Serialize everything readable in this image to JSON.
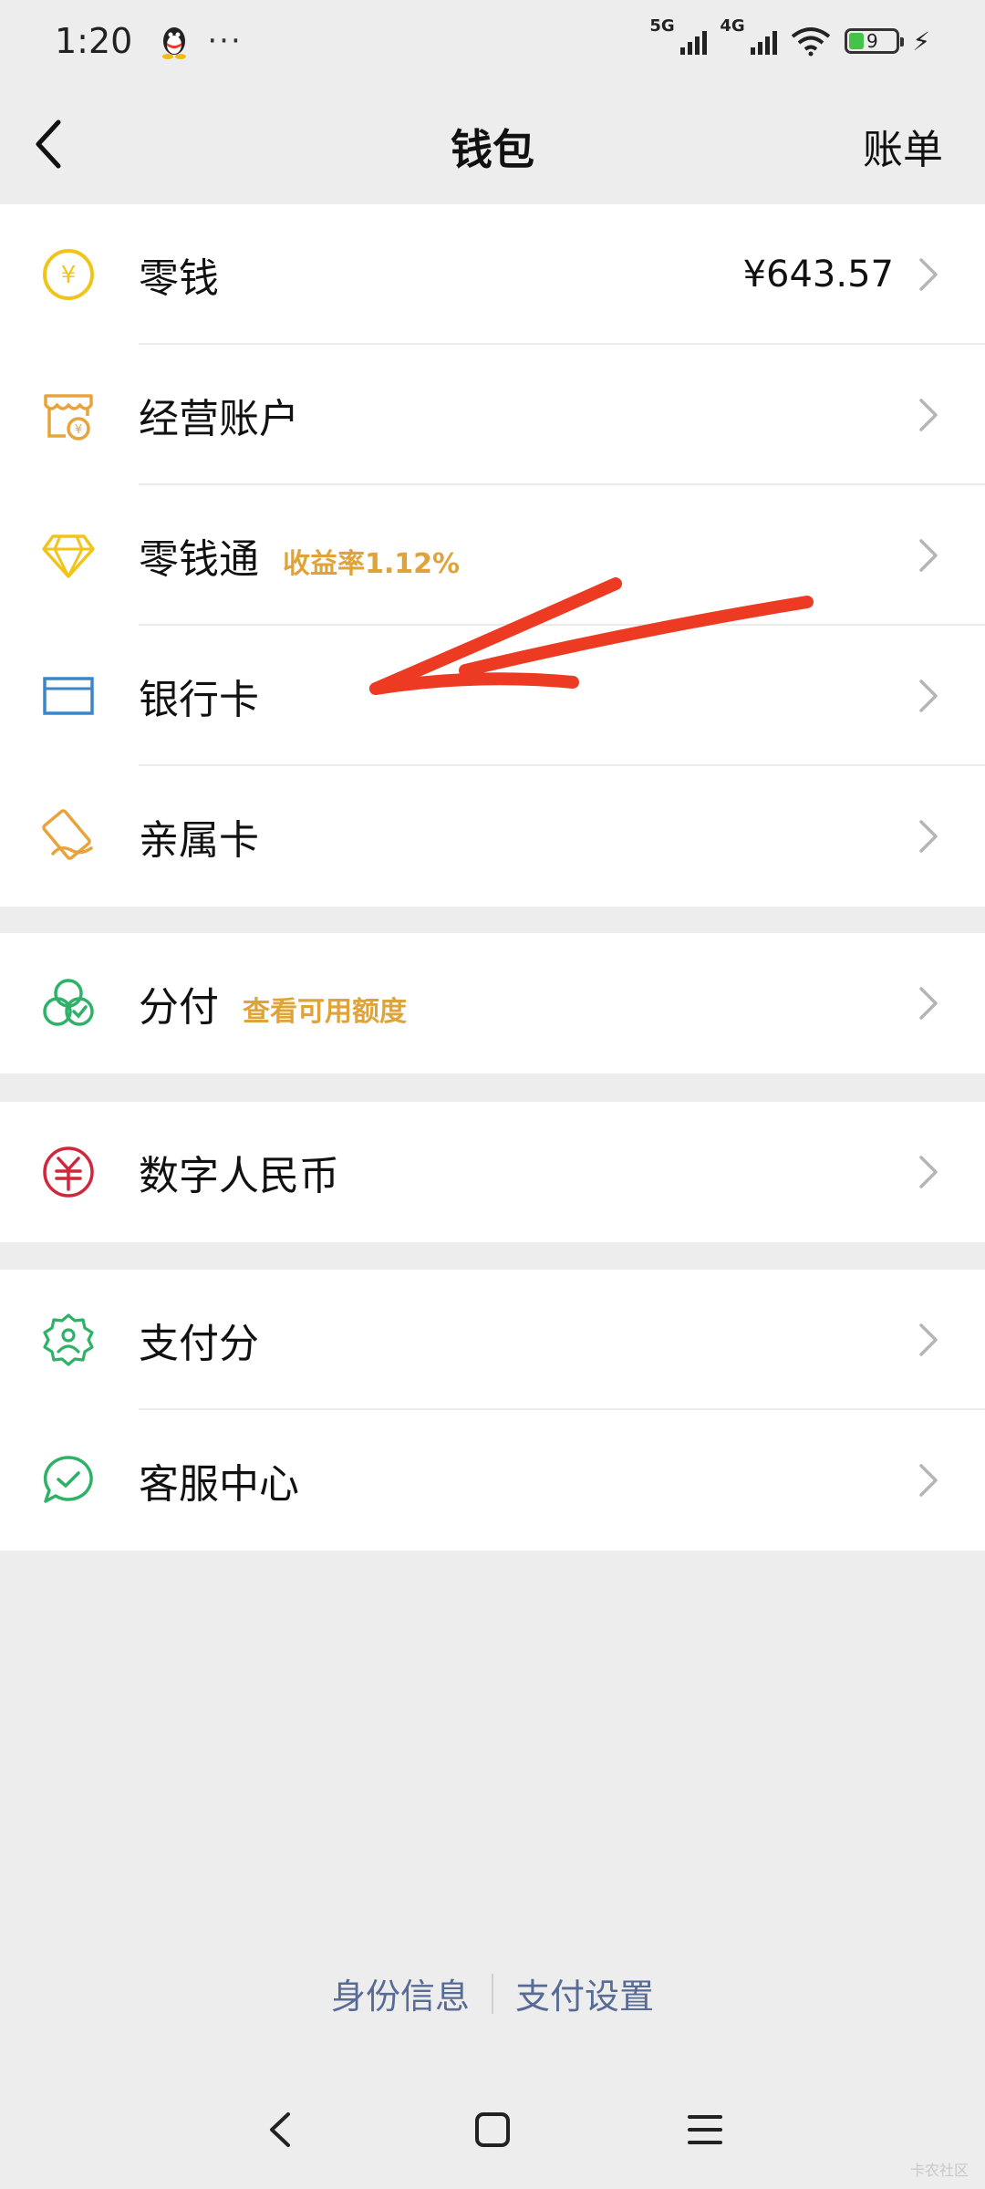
{
  "status_bar": {
    "time": "1:20",
    "dots": "···",
    "sig1": "5G",
    "sig2": "4G",
    "battery": "9"
  },
  "nav": {
    "title": "钱包",
    "bill": "账单"
  },
  "group1": {
    "items": [
      {
        "label": "零钱",
        "value": "¥643.57"
      },
      {
        "label": "经营账户"
      },
      {
        "label": "零钱通",
        "tag": "收益率1.12%"
      },
      {
        "label": "银行卡"
      },
      {
        "label": "亲属卡"
      }
    ]
  },
  "group2": {
    "items": [
      {
        "label": "分付",
        "tag": "查看可用额度"
      }
    ]
  },
  "group3": {
    "items": [
      {
        "label": "数字人民币"
      }
    ]
  },
  "group4": {
    "items": [
      {
        "label": "支付分"
      },
      {
        "label": "客服中心"
      }
    ]
  },
  "footer": {
    "identity": "身份信息",
    "pay_settings": "支付设置"
  },
  "watermark": "卡农社区",
  "colors": {
    "yellow": "#f0c419",
    "orange": "#e8a33c",
    "blue": "#3b86c8",
    "green": "#2fb167",
    "red": "#d0273a",
    "link": "#576b95",
    "annotation": "#ec3b22"
  },
  "icons": {
    "change": "yuan-coin-icon",
    "business": "shop-icon",
    "lqt": "diamond-icon",
    "bankcard": "card-icon",
    "family": "family-card-icon",
    "fenfu": "fenfu-icon",
    "ecny": "digital-rmb-icon",
    "score": "payment-score-icon",
    "service": "customer-service-icon"
  }
}
